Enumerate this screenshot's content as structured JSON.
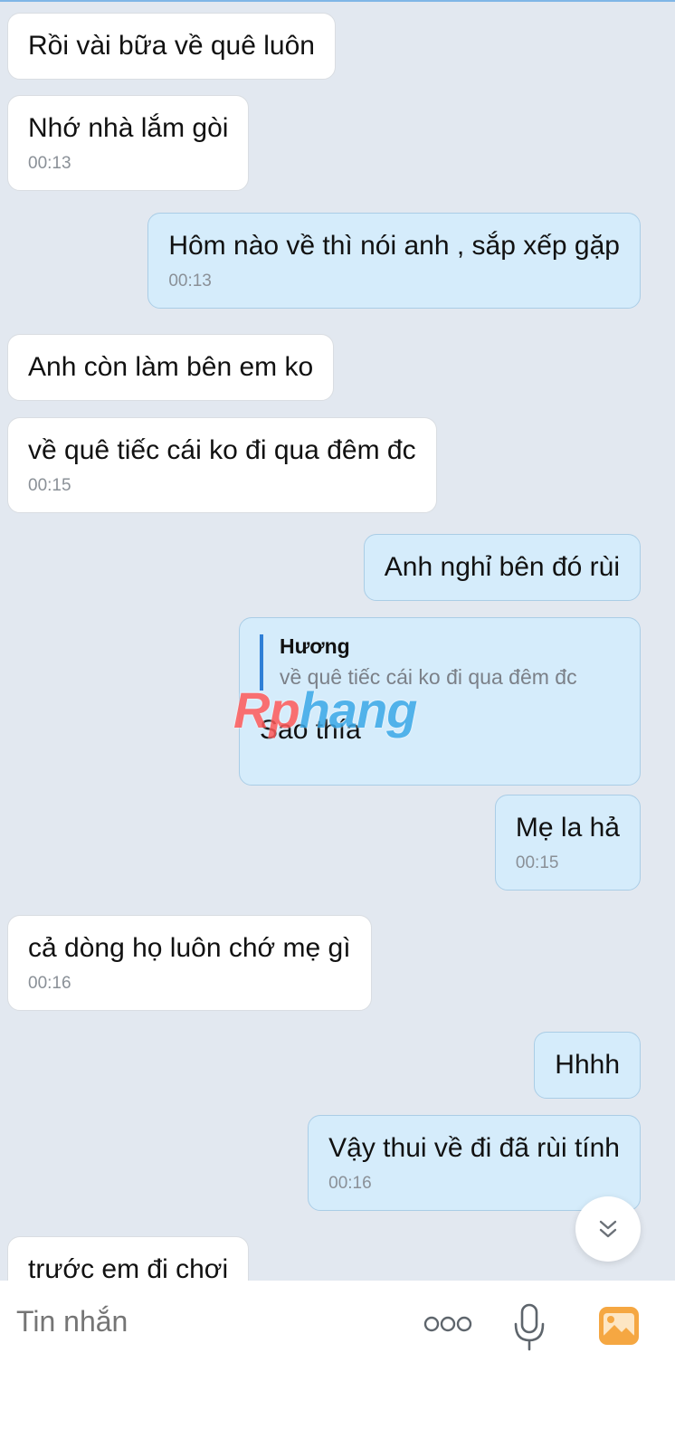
{
  "messages": [
    {
      "text": "Rồi vài bữa về quê luôn"
    },
    {
      "text": "Nhớ nhà lắm gòi",
      "time": "00:13"
    },
    {
      "text": "Hôm nào về thì nói anh , sắp xếp gặp",
      "time": "00:13"
    },
    {
      "text": "Anh còn làm bên em ko"
    },
    {
      "text": "về quê tiếc cái ko đi qua đêm đc",
      "time": "00:15"
    },
    {
      "text": "Anh nghỉ bên đó rùi"
    },
    {
      "text": "Sao thía",
      "reply_name": "Hương",
      "reply_text": "về quê tiếc cái ko đi qua đêm đc"
    },
    {
      "text": "Mẹ la hả",
      "time": "00:15"
    },
    {
      "text": "cả dòng họ luôn chớ mẹ gì",
      "time": "00:16"
    },
    {
      "text": "Hhhh"
    },
    {
      "text": "Vậy thui về đi đã rùi tính",
      "time": "00:16"
    },
    {
      "text": "trước em đi chơi"
    }
  ],
  "watermark": {
    "part1": "Rp",
    "part2": "hang"
  },
  "composer": {
    "placeholder": "Tin nhắn"
  },
  "icons": {
    "scroll": "chevron-double-down-icon",
    "more": "more-dots-icon",
    "mic": "microphone-icon",
    "image": "image-gallery-icon"
  },
  "colors": {
    "background": "#e2e8f0",
    "incoming": "#ffffff",
    "outgoing": "#d5ecfb",
    "accent": "#2f7fd6",
    "image_icon": "#f5a742"
  }
}
